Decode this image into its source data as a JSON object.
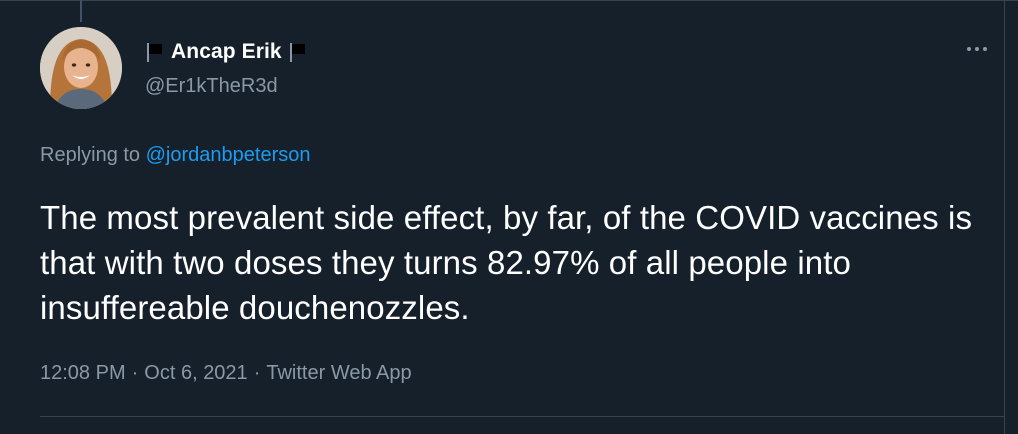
{
  "tweet": {
    "display_name": "Ancap Erik",
    "handle": "@Er1kTheR3d",
    "reply_prefix": "Replying to",
    "reply_to": "@jordanbpeterson",
    "text": "The most prevalent side effect, by far, of the COVID vaccines is that with two doses they turns 82.97% of all people into insuffereable douchenozzles.",
    "time": "12:08 PM",
    "separator": "·",
    "date": "Oct 6, 2021",
    "source": "Twitter Web App"
  },
  "icons": {
    "name_prefix": "black-flag-icon",
    "name_suffix": "black-flag-icon",
    "more": "more-horizontal-icon"
  },
  "colors": {
    "background": "#15202b",
    "text_primary": "#ffffff",
    "text_secondary": "#8b98a5",
    "link": "#1d9bf0",
    "border": "#38444d"
  }
}
